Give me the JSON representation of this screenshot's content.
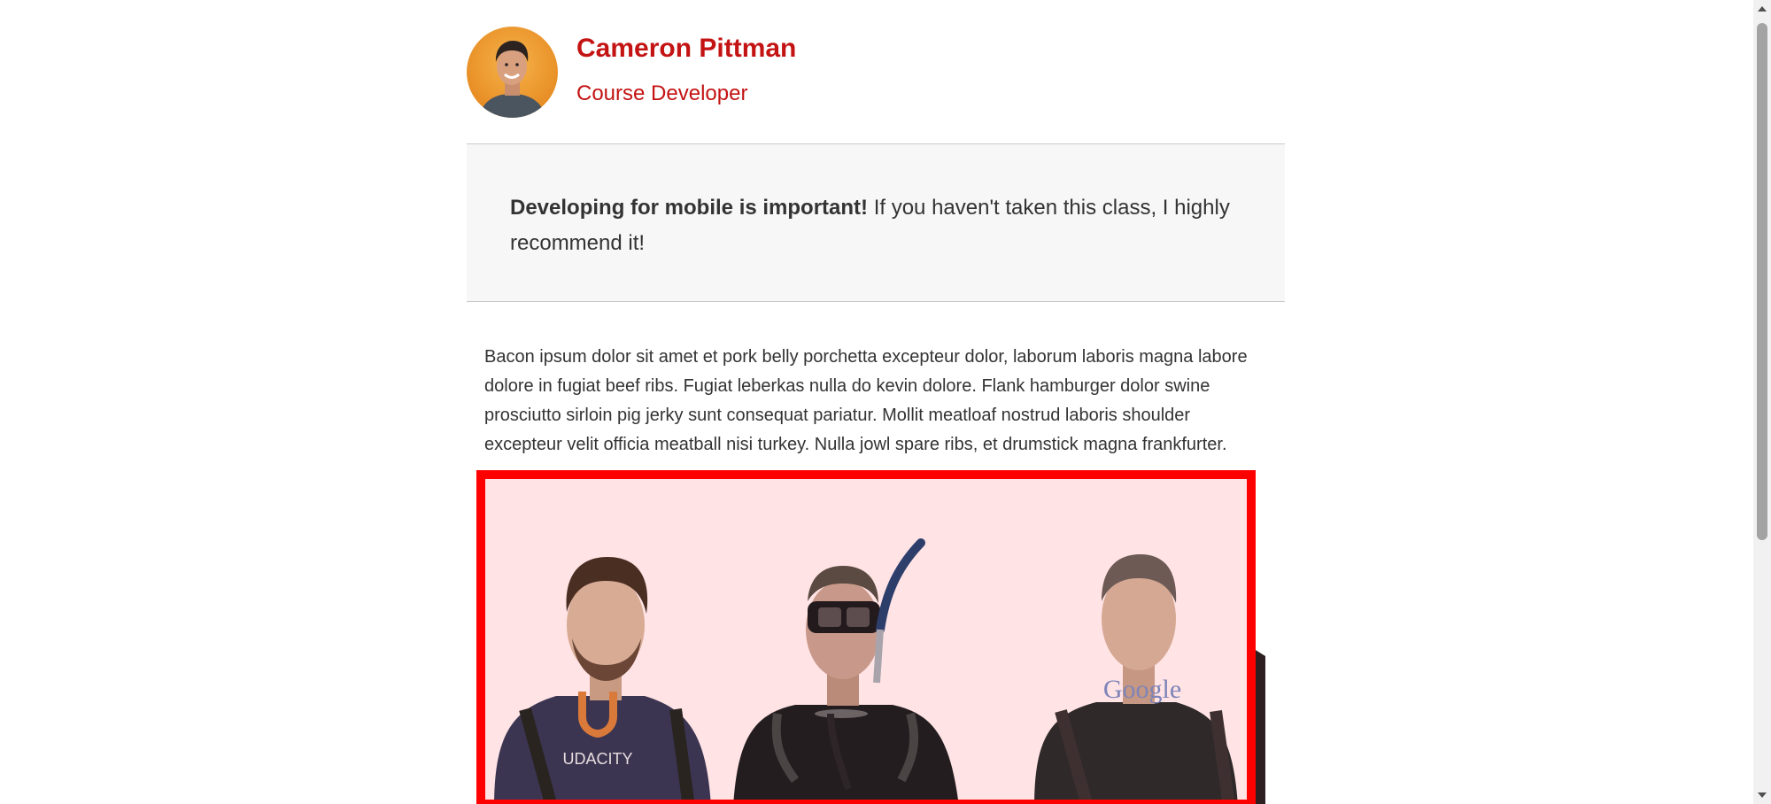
{
  "author": {
    "name": "Cameron Pittman",
    "title": "Course Developer",
    "avatar_icon": "person-avatar"
  },
  "callout": {
    "bold": "Developing for mobile is important!",
    "rest": " If you haven't taken this class, I highly recommend it!"
  },
  "body": {
    "paragraph": "Bacon ipsum dolor sit amet et pork belly porchetta excepteur dolor, laborum laboris magna labore dolore in fugiat beef ribs. Fugiat leberkas nulla do kevin dolore. Flank hamburger dolor swine prosciutto sirloin pig jerky sunt consequat pariatur. Mollit meatloaf nostrud laboris shoulder excepteur velit officia meatball nisi turkey. Nulla jowl spare ribs, et drumstick magna frankfurter."
  },
  "photo": {
    "shirt_left_text": "UDACITY",
    "shirt_right_text": "Google",
    "border_color": "#ff0000",
    "tint_color": "#ffe3e5"
  },
  "colors": {
    "accent": "#c41313",
    "callout_bg": "#f7f7f7",
    "text": "#333333"
  }
}
